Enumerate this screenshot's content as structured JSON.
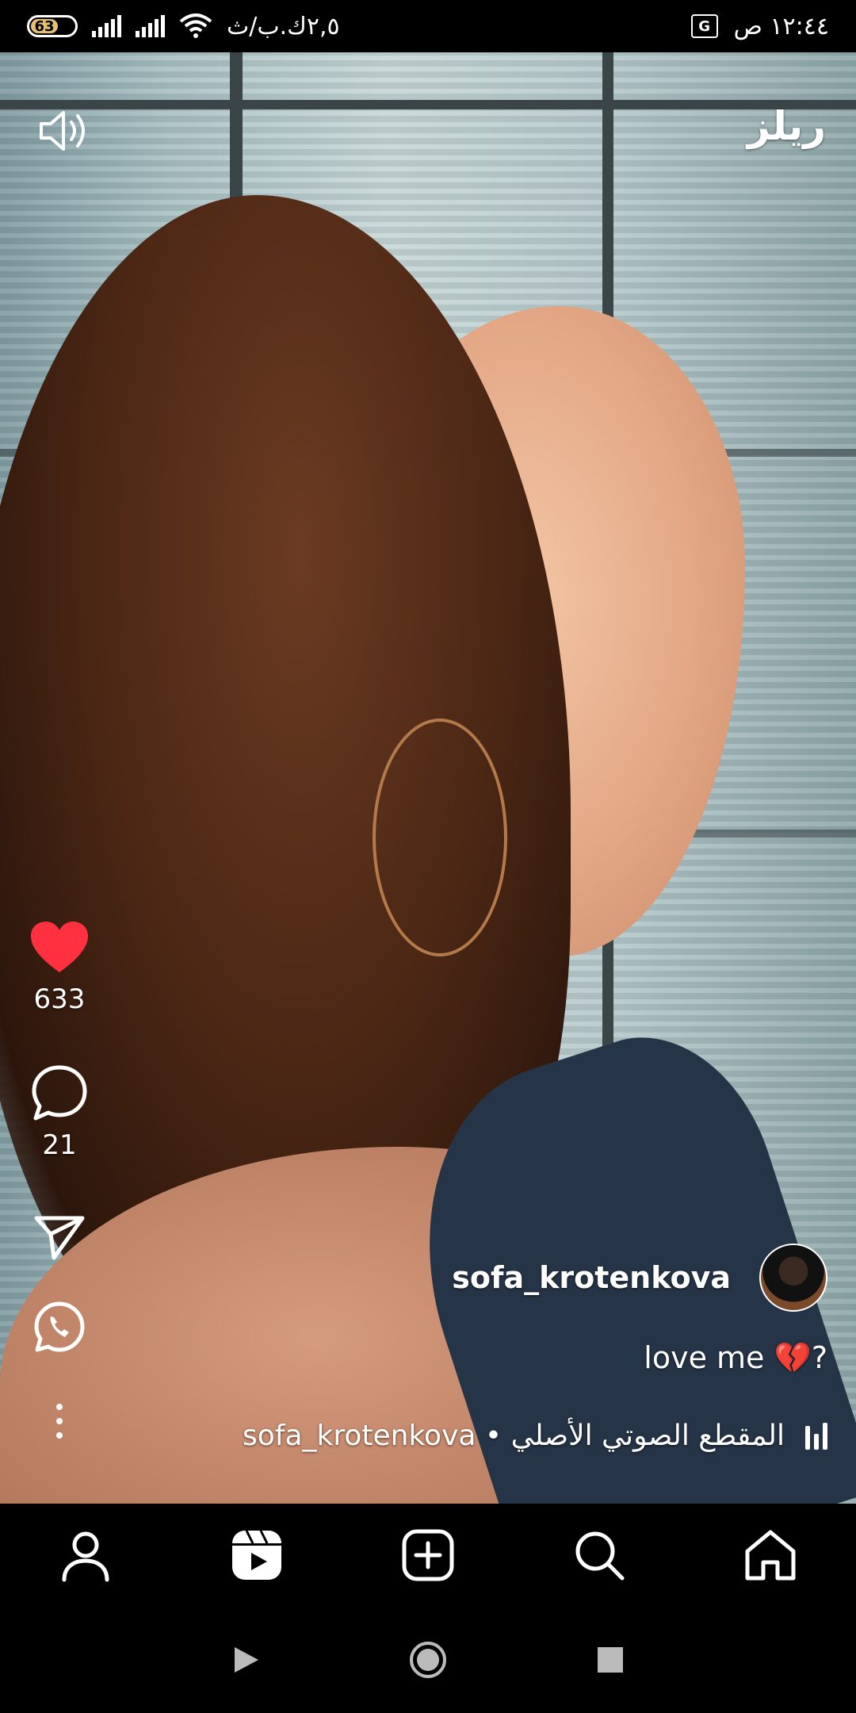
{
  "status_bar": {
    "battery_level": "63",
    "network_speed": "٢,٥ك.ب/ث",
    "time": "١٢:٤٤ ص"
  },
  "header": {
    "title": "ريلز",
    "volume_icon": "speaker-icon"
  },
  "actions": {
    "like": {
      "icon": "heart-icon",
      "count": "633",
      "color": "#ff3040"
    },
    "comment": {
      "icon": "comment-icon",
      "count": "21"
    },
    "share": {
      "icon": "paper-plane-icon"
    },
    "whatsapp": {
      "icon": "whatsapp-icon"
    },
    "more": {
      "icon": "more-vertical-icon"
    }
  },
  "post": {
    "author": "sofa_krotenkova",
    "caption": "love me 💔?",
    "audio": "sofa_krotenkova • المقطع الصوتي الأصلي"
  },
  "bottom_nav": [
    "profile-icon",
    "reels-icon",
    "create-icon",
    "search-icon",
    "home-icon"
  ],
  "system_nav": [
    "back-icon",
    "home-circle-icon",
    "recents-icon"
  ]
}
